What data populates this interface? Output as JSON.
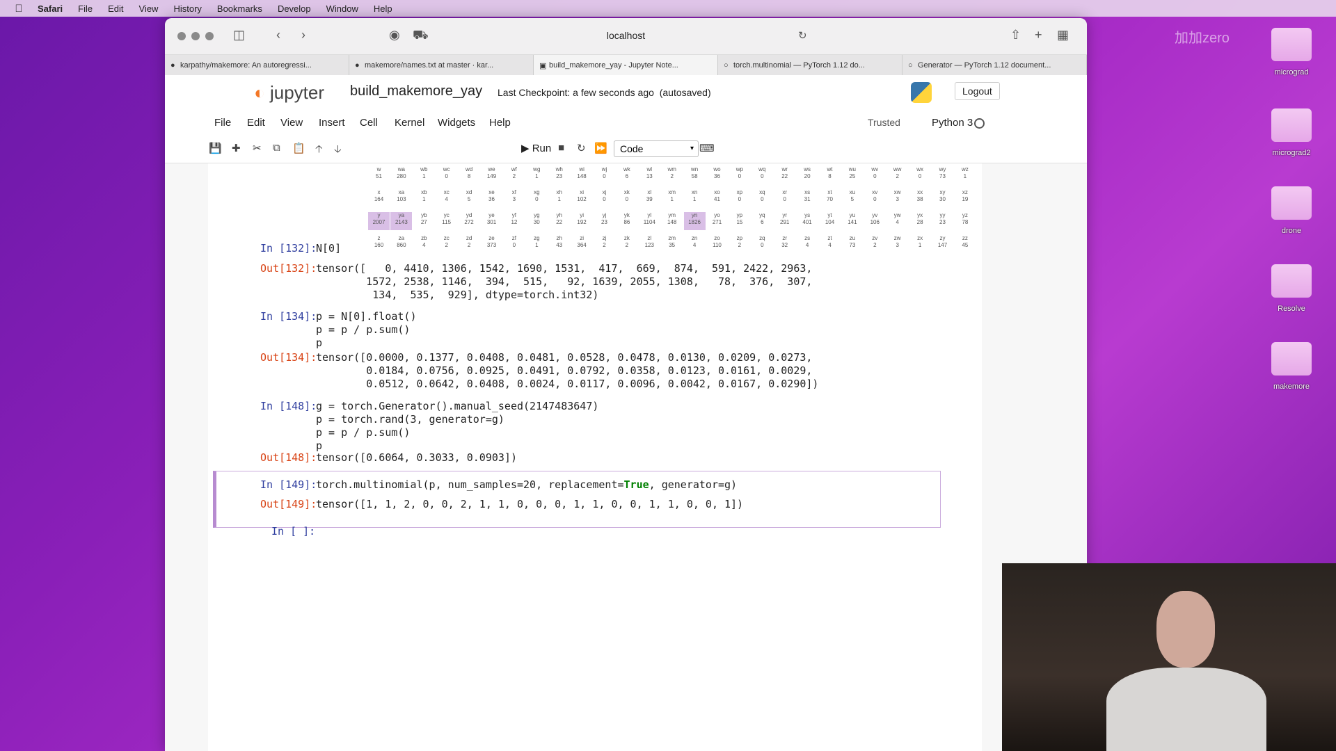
{
  "menubar": {
    "app": "Safari",
    "items": [
      "File",
      "Edit",
      "View",
      "History",
      "Bookmarks",
      "Develop",
      "Window",
      "Help"
    ]
  },
  "browser": {
    "address": "localhost",
    "tabs": [
      {
        "label": "karpathy/makemore: An autoregressi...",
        "icon": "github-icon"
      },
      {
        "label": "makemore/names.txt at master · kar...",
        "icon": "github-icon"
      },
      {
        "label": "build_makemore_yay - Jupyter Note...",
        "icon": "notebook-icon",
        "active": true
      },
      {
        "label": "torch.multinomial — PyTorch 1.12 do...",
        "icon": "pytorch-icon"
      },
      {
        "label": "Generator — PyTorch 1.12 document...",
        "icon": "pytorch-icon"
      }
    ]
  },
  "jupyter": {
    "logo": "jupyter",
    "notebook_title": "build_makemore_yay",
    "checkpoint": "Last Checkpoint: a few seconds ago",
    "autosaved": "(autosaved)",
    "logout": "Logout",
    "menu": [
      "File",
      "Edit",
      "View",
      "Insert",
      "Cell",
      "Kernel",
      "Widgets",
      "Help"
    ],
    "trusted": "Trusted",
    "kernel": "Python 3",
    "run_label": "Run",
    "cell_type": "Code"
  },
  "bigram_grid": {
    "rows": [
      [
        [
          "w",
          "51"
        ],
        [
          "wa",
          "280"
        ],
        [
          "wb",
          "1"
        ],
        [
          "wc",
          "0"
        ],
        [
          "wd",
          "8"
        ],
        [
          "we",
          "149"
        ],
        [
          "wf",
          "2"
        ],
        [
          "wg",
          "1"
        ],
        [
          "wh",
          "23"
        ],
        [
          "wi",
          "148"
        ],
        [
          "wj",
          "0"
        ],
        [
          "wk",
          "6"
        ],
        [
          "wl",
          "13"
        ],
        [
          "wm",
          "2"
        ],
        [
          "wn",
          "58"
        ],
        [
          "wo",
          "36"
        ],
        [
          "wp",
          "0"
        ],
        [
          "wq",
          "0"
        ],
        [
          "wr",
          "22"
        ],
        [
          "ws",
          "20"
        ],
        [
          "wt",
          "8"
        ],
        [
          "wu",
          "25"
        ],
        [
          "wv",
          "0"
        ],
        [
          "ww",
          "2"
        ],
        [
          "wx",
          "0"
        ],
        [
          "wy",
          "73"
        ],
        [
          "wz",
          "1"
        ]
      ],
      [
        [
          "x",
          "164"
        ],
        [
          "xa",
          "103"
        ],
        [
          "xb",
          "1"
        ],
        [
          "xc",
          "4"
        ],
        [
          "xd",
          "5"
        ],
        [
          "xe",
          "36"
        ],
        [
          "xf",
          "3"
        ],
        [
          "xg",
          "0"
        ],
        [
          "xh",
          "1"
        ],
        [
          "xi",
          "102"
        ],
        [
          "xj",
          "0"
        ],
        [
          "xk",
          "0"
        ],
        [
          "xl",
          "39"
        ],
        [
          "xm",
          "1"
        ],
        [
          "xn",
          "1"
        ],
        [
          "xo",
          "41"
        ],
        [
          "xp",
          "0"
        ],
        [
          "xq",
          "0"
        ],
        [
          "xr",
          "0"
        ],
        [
          "xs",
          "31"
        ],
        [
          "xt",
          "70"
        ],
        [
          "xu",
          "5"
        ],
        [
          "xv",
          "0"
        ],
        [
          "xw",
          "3"
        ],
        [
          "xx",
          "38"
        ],
        [
          "xy",
          "30"
        ],
        [
          "xz",
          "19"
        ]
      ],
      [
        [
          "y",
          "2007"
        ],
        [
          "ya",
          "2143"
        ],
        [
          "yb",
          "27"
        ],
        [
          "yc",
          "115"
        ],
        [
          "yd",
          "272"
        ],
        [
          "ye",
          "301"
        ],
        [
          "yf",
          "12"
        ],
        [
          "yg",
          "30"
        ],
        [
          "yh",
          "22"
        ],
        [
          "yi",
          "192"
        ],
        [
          "yj",
          "23"
        ],
        [
          "yk",
          "86"
        ],
        [
          "yl",
          "1104"
        ],
        [
          "ym",
          "148"
        ],
        [
          "yn",
          "1826"
        ],
        [
          "yo",
          "271"
        ],
        [
          "yp",
          "15"
        ],
        [
          "yq",
          "6"
        ],
        [
          "yr",
          "291"
        ],
        [
          "ys",
          "401"
        ],
        [
          "yt",
          "104"
        ],
        [
          "yu",
          "141"
        ],
        [
          "yv",
          "106"
        ],
        [
          "yw",
          "4"
        ],
        [
          "yx",
          "28"
        ],
        [
          "yy",
          "23"
        ],
        [
          "yz",
          "78"
        ]
      ],
      [
        [
          "z",
          "160"
        ],
        [
          "za",
          "860"
        ],
        [
          "zb",
          "4"
        ],
        [
          "zc",
          "2"
        ],
        [
          "zd",
          "2"
        ],
        [
          "ze",
          "373"
        ],
        [
          "zf",
          "0"
        ],
        [
          "zg",
          "1"
        ],
        [
          "zh",
          "43"
        ],
        [
          "zi",
          "364"
        ],
        [
          "zj",
          "2"
        ],
        [
          "zk",
          "2"
        ],
        [
          "zl",
          "123"
        ],
        [
          "zm",
          "35"
        ],
        [
          "zn",
          "4"
        ],
        [
          "zo",
          "110"
        ],
        [
          "zp",
          "2"
        ],
        [
          "zq",
          "0"
        ],
        [
          "zr",
          "32"
        ],
        [
          "zs",
          "4"
        ],
        [
          "zt",
          "4"
        ],
        [
          "zu",
          "73"
        ],
        [
          "zv",
          "2"
        ],
        [
          "zw",
          "3"
        ],
        [
          "zx",
          "1"
        ],
        [
          "zy",
          "147"
        ],
        [
          "zz",
          "45"
        ]
      ]
    ]
  },
  "cells": [
    {
      "in": "In [132]:",
      "code": "N[0]",
      "out": "Out[132]:",
      "output": "tensor([   0, 4410, 1306, 1542, 1690, 1531,  417,  669,  874,  591, 2422, 2963,\n        1572, 2538, 1146,  394,  515,   92, 1639, 2055, 1308,   78,  376,  307,\n         134,  535,  929], dtype=torch.int32)"
    },
    {
      "in": "In [134]:",
      "code": "p = N[0].float()\np = p / p.sum()\np",
      "out": "Out[134]:",
      "output": "tensor([0.0000, 0.1377, 0.0408, 0.0481, 0.0528, 0.0478, 0.0130, 0.0209, 0.0273,\n        0.0184, 0.0756, 0.0925, 0.0491, 0.0792, 0.0358, 0.0123, 0.0161, 0.0029,\n        0.0512, 0.0642, 0.0408, 0.0024, 0.0117, 0.0096, 0.0042, 0.0167, 0.0290])"
    },
    {
      "in": "In [148]:",
      "code": "g = torch.Generator().manual_seed(2147483647)\np = torch.rand(3, generator=g)\np = p / p.sum()\np",
      "out": "Out[148]:",
      "output": "tensor([0.6064, 0.3033, 0.0903])"
    },
    {
      "in": "In [149]:",
      "code_pre": "torch.multinomial(p, num_samples=20, replacement=",
      "code_kw": "True",
      "code_post": ", generator=g)",
      "out": "Out[149]:",
      "output": "tensor([1, 1, 2, 0, 0, 2, 1, 1, 0, 0, 0, 1, 1, 0, 0, 1, 1, 0, 0, 1])"
    },
    {
      "in": "In [ ]:"
    }
  ],
  "desktop": {
    "watermark": "加加zero",
    "icons": [
      "micrograd",
      "micrograd2",
      "drone",
      "Resolve",
      "makemore"
    ]
  }
}
